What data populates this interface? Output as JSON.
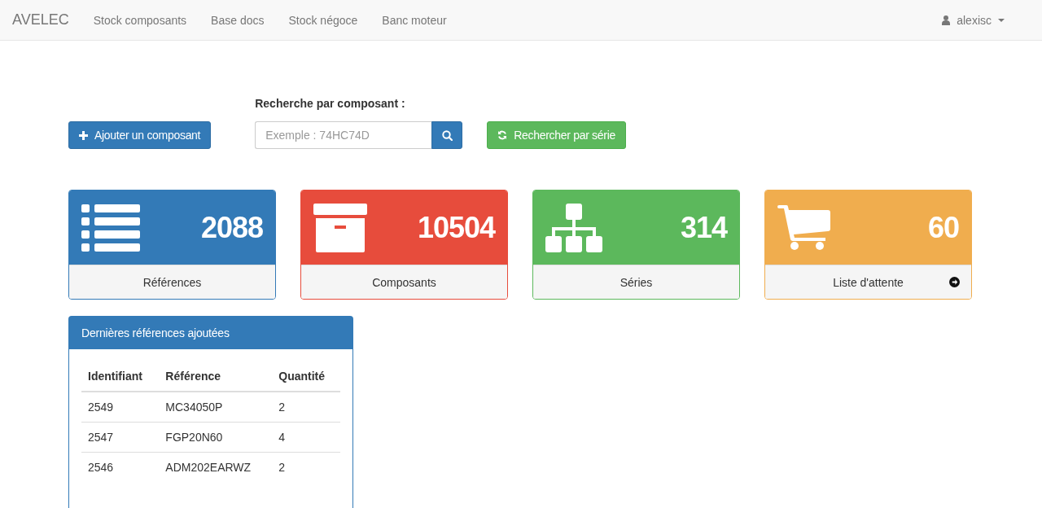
{
  "navbar": {
    "brand": "AVELEC",
    "items": [
      "Stock composants",
      "Base docs",
      "Stock négoce",
      "Banc moteur"
    ],
    "user": "alexisc"
  },
  "actions": {
    "add_button": "Ajouter un composant",
    "search_label": "Recherche par composant :",
    "search": {
      "placeholder": "Exemple : 74HC74D"
    },
    "series_button": "Rechercher par série"
  },
  "tiles": [
    {
      "kind": "list",
      "color": "#337ab7",
      "count": "2088",
      "label": "Références",
      "arrow": false
    },
    {
      "kind": "archive",
      "color": "#e74c3c",
      "count": "10504",
      "label": "Composants",
      "arrow": false
    },
    {
      "kind": "sitemap",
      "color": "#5cb85c",
      "count": "314",
      "label": "Séries",
      "arrow": false
    },
    {
      "kind": "cart",
      "color": "#f0ad4e",
      "count": "60",
      "label": "Liste d'attente",
      "arrow": true
    }
  ],
  "recent_panel": {
    "title": "Dernières références ajoutées",
    "columns": [
      "Identifiant",
      "Référence",
      "Quantité"
    ],
    "rows": [
      [
        "2549",
        "MC34050P",
        "2"
      ],
      [
        "2547",
        "FGP20N60",
        "4"
      ],
      [
        "2546",
        "ADM202EARWZ",
        "2"
      ]
    ]
  }
}
